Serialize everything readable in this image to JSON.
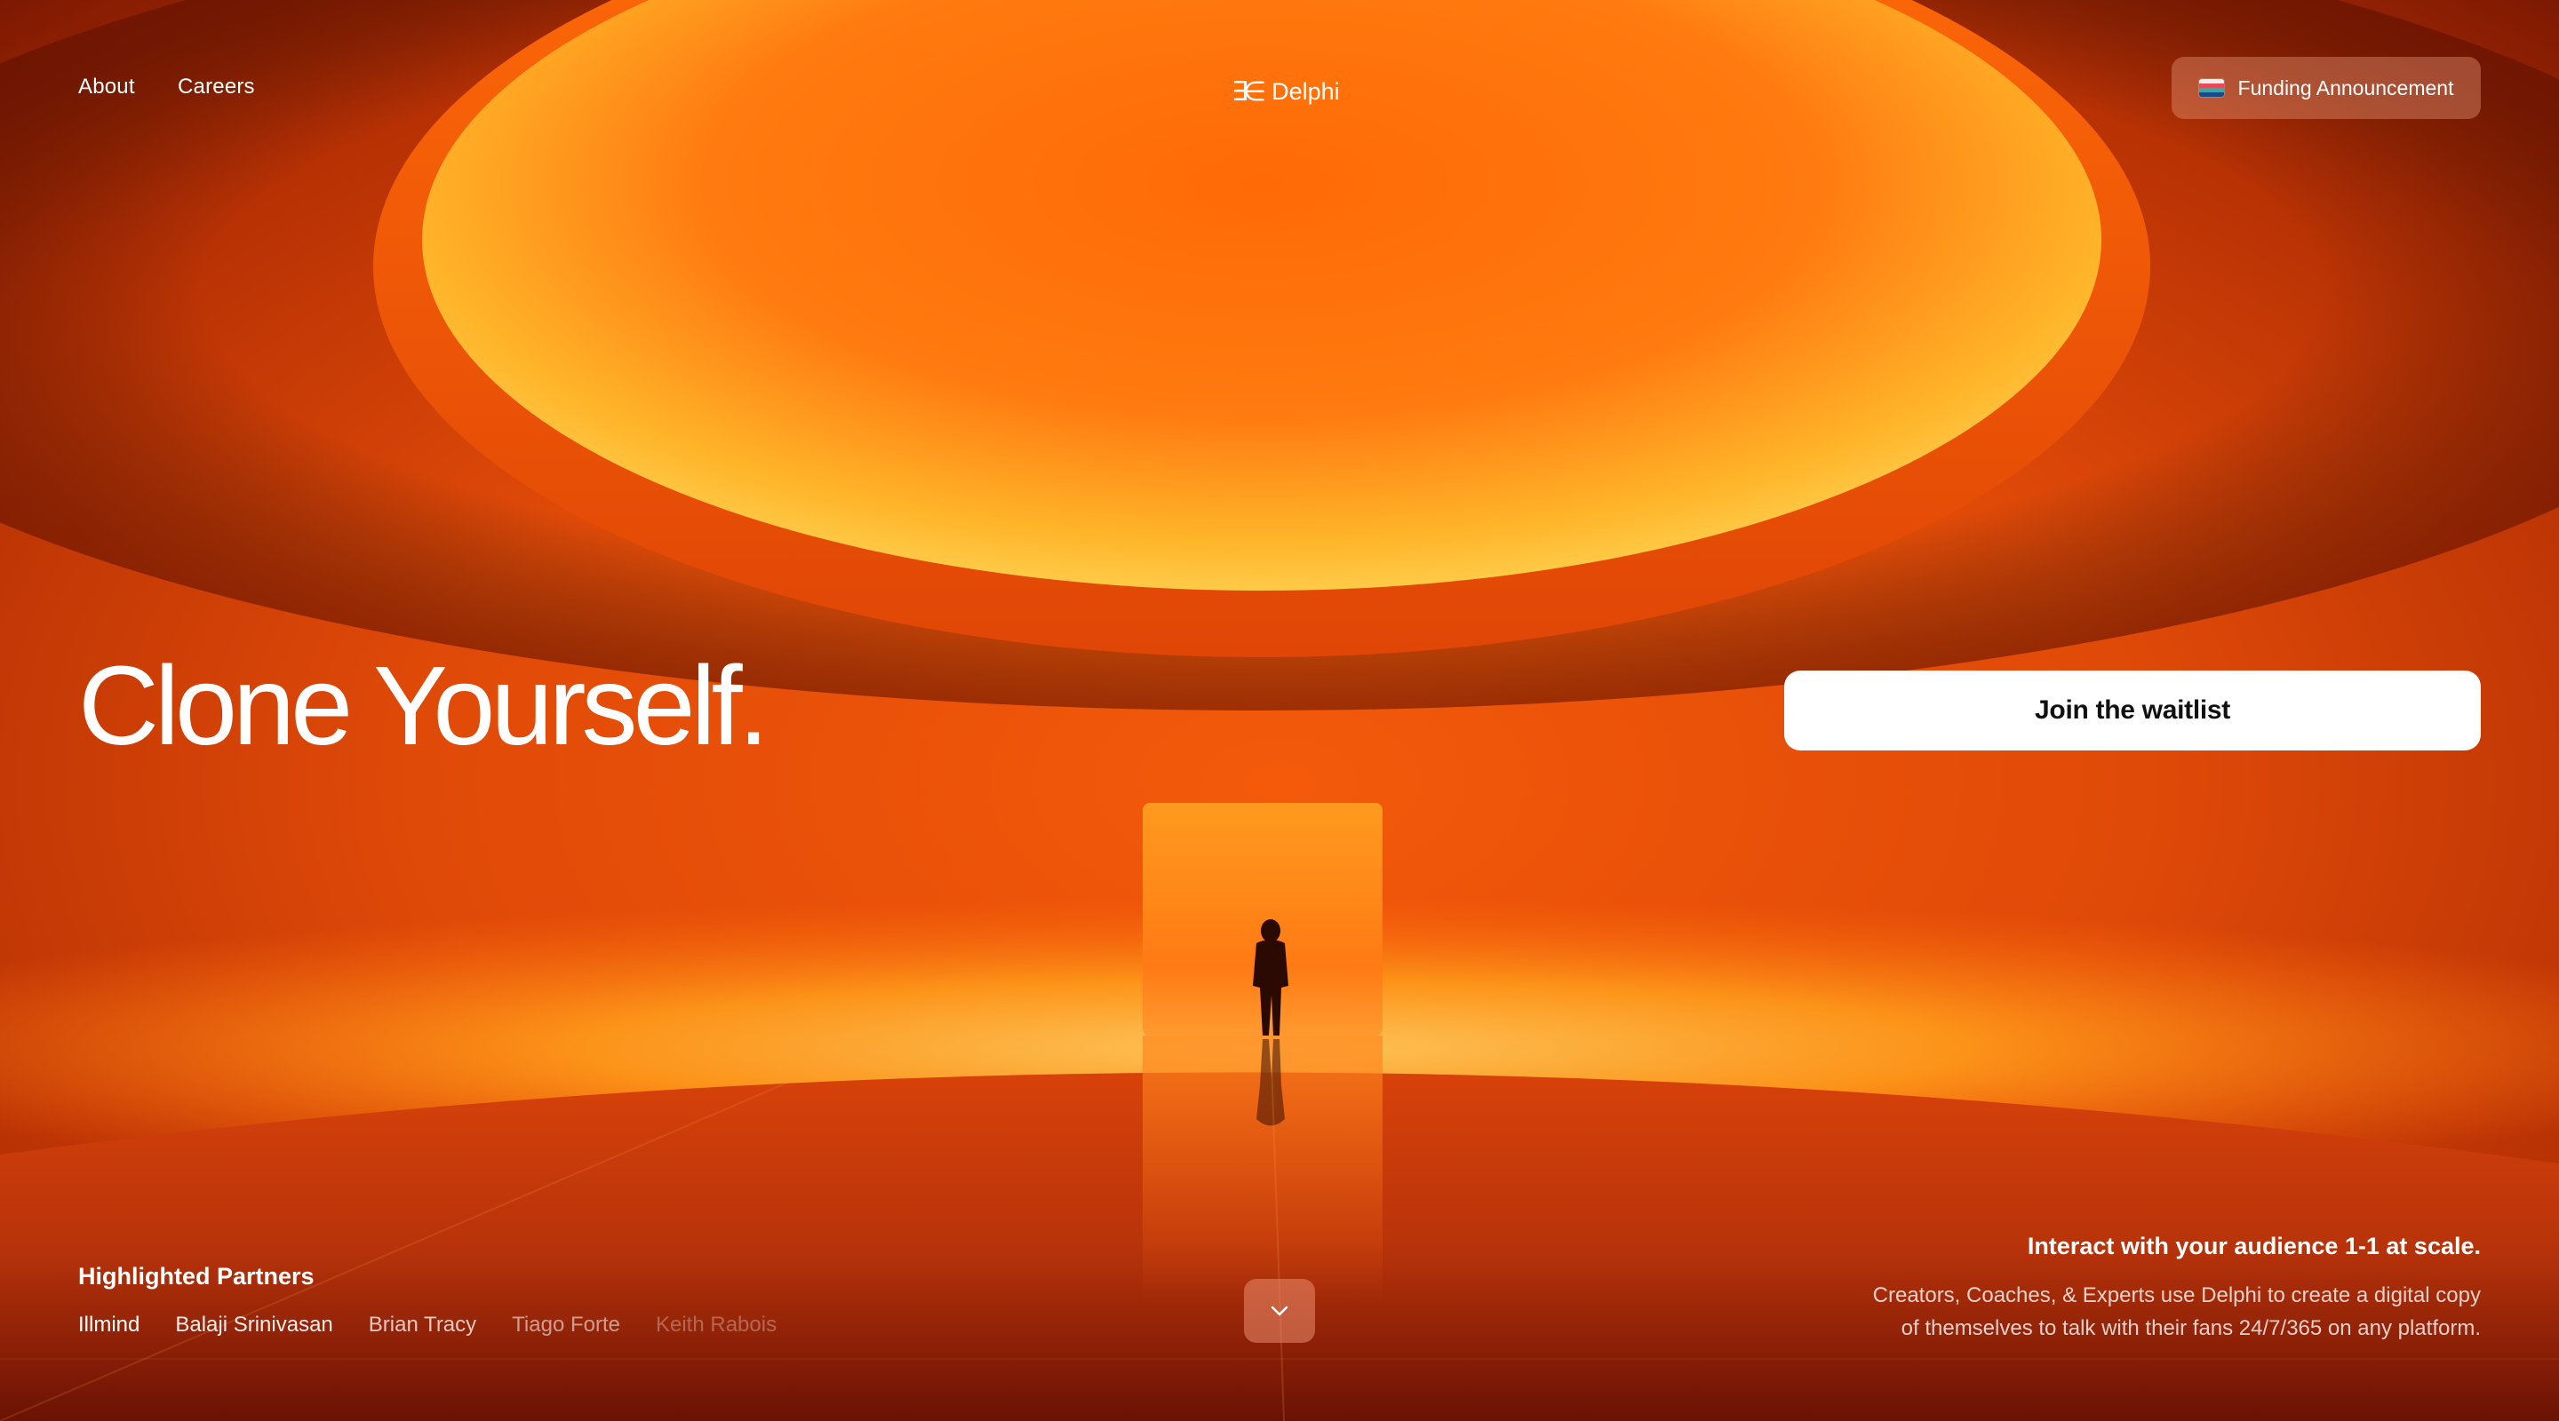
{
  "nav": {
    "about": "About",
    "careers": "Careers"
  },
  "brand": {
    "icon": "delphi-logo-icon",
    "name": "Delphi"
  },
  "funding": {
    "label": "Funding Announcement",
    "icon": "flag-icon"
  },
  "hero": {
    "title": "Clone Yourself.",
    "cta": "Join the waitlist"
  },
  "partners": {
    "heading": "Highlighted Partners",
    "items": [
      "Illmind",
      "Balaji Srinivasan",
      "Brian Tracy",
      "Tiago Forte",
      "Keith Rabois"
    ]
  },
  "scroll": {
    "icon": "chevron-down-icon"
  },
  "info": {
    "tagline": "Interact with your audience 1-1 at scale.",
    "line1": "Creators, Coaches, & Experts use Delphi to create a digital copy",
    "line2": "of themselves to talk with their fans 24/7/365 on any platform."
  },
  "colors": {
    "background": "#c23a06",
    "glow": "#ffb31a",
    "ceiling_light": "#ff7a0a",
    "cta_bg": "#ffffff",
    "cta_text": "#111111"
  }
}
